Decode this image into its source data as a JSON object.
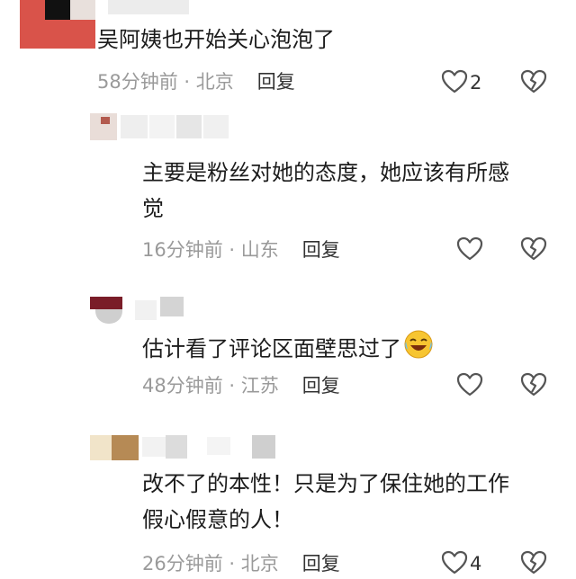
{
  "comments": [
    {
      "text_lines": [
        "吴阿姨也开始关心泡泡了"
      ],
      "meta": "58分钟前 · 北京",
      "reply": "回复",
      "likes": "2",
      "like_icon": "heart-outline-icon",
      "dislike_icon": "broken-heart-icon"
    },
    {
      "text_lines": [
        "主要是粉丝对她的态度，她应该有所感",
        "觉"
      ],
      "meta": "16分钟前 · 山东",
      "reply": "回复",
      "like_icon": "heart-outline-icon",
      "dislike_icon": "broken-heart-icon"
    },
    {
      "text_lines": [
        "估计看了评论区面壁思过了"
      ],
      "emoji": "laughing-crying-emoji",
      "meta": "48分钟前 · 江苏",
      "reply": "回复",
      "like_icon": "heart-outline-icon",
      "dislike_icon": "broken-heart-icon"
    },
    {
      "text_lines": [
        "改不了的本性！只是为了保住她的工作",
        "假心假意的人！"
      ],
      "meta": "26分钟前 · 北京",
      "reply": "回复",
      "likes": "4",
      "like_icon": "heart-outline-icon",
      "dislike_icon": "broken-heart-icon"
    }
  ],
  "colors": {
    "text": "#1c1c1c",
    "meta": "#9a9a9a",
    "icon": "#555555"
  }
}
